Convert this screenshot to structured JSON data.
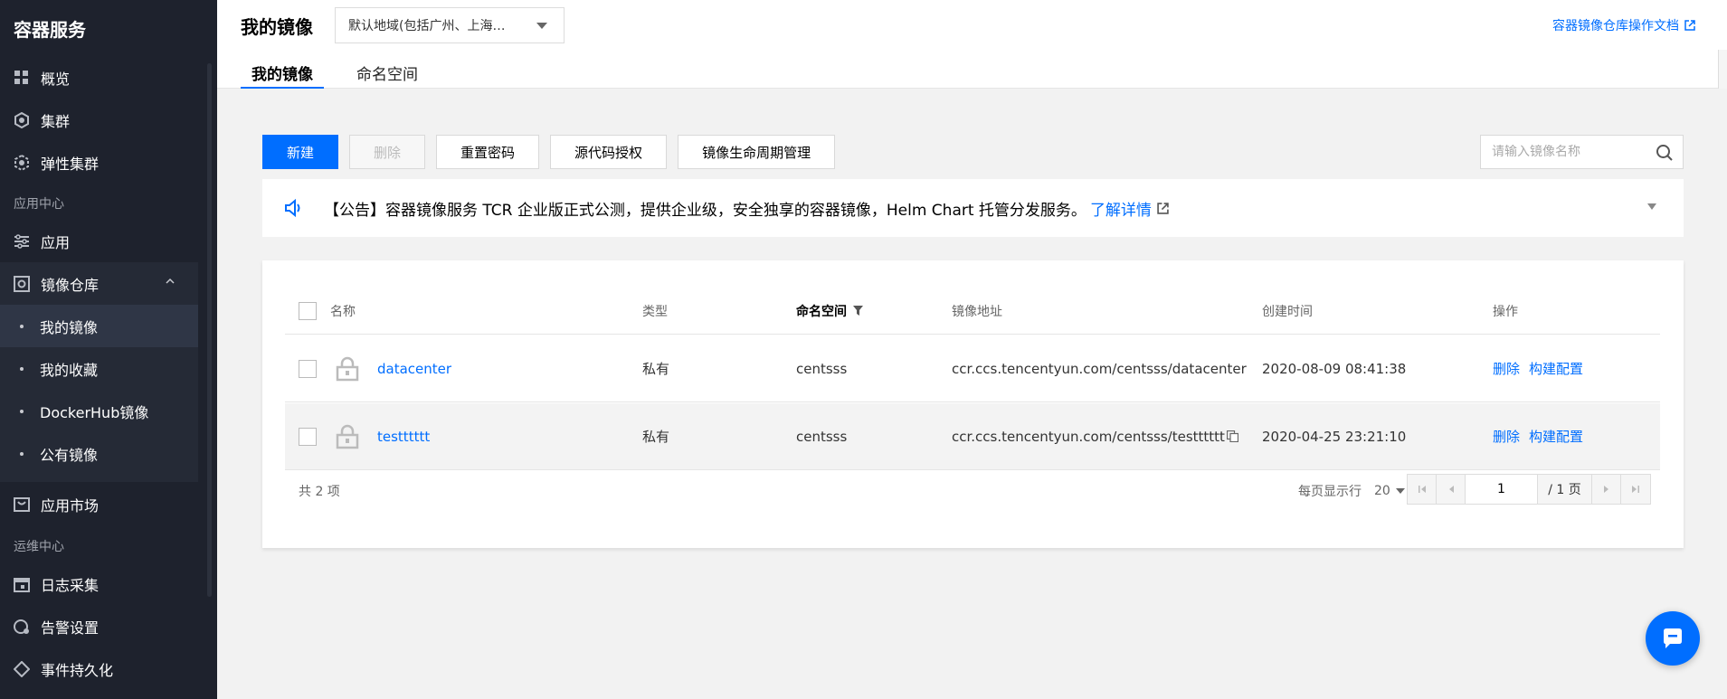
{
  "sidebar": {
    "brand": "容器服务",
    "items_top": [
      {
        "label": "概览",
        "icon": "grid-icon"
      },
      {
        "label": "集群",
        "icon": "cluster-icon"
      },
      {
        "label": "弹性集群",
        "icon": "elastic-cluster-icon"
      }
    ],
    "group_app": "应用中心",
    "app_item": {
      "label": "应用",
      "icon": "app-icon"
    },
    "registry": {
      "label": "镜像仓库",
      "icon": "registry-icon"
    },
    "registry_sub": [
      "我的镜像",
      "我的收藏",
      "DockerHub镜像",
      "公有镜像"
    ],
    "market": {
      "label": "应用市场",
      "icon": "market-icon"
    },
    "group_ops": "运维中心",
    "ops_items": [
      {
        "label": "日志采集",
        "icon": "calendar-icon"
      },
      {
        "label": "告警设置",
        "icon": "alarm-icon"
      },
      {
        "label": "事件持久化",
        "icon": "event-icon"
      }
    ]
  },
  "header": {
    "title": "我的镜像",
    "region": "默认地域(包括广州、上海…",
    "doc_link": "容器镜像仓库操作文档",
    "tabs": [
      "我的镜像",
      "命名空间"
    ]
  },
  "toolbar": {
    "new": "新建",
    "delete": "删除",
    "reset_pwd": "重置密码",
    "source_auth": "源代码授权",
    "lifecycle": "镜像生命周期管理",
    "search_placeholder": "请输入镜像名称"
  },
  "announcement": {
    "text": "【公告】容器镜像服务 TCR 企业版正式公测，提供企业级，安全独享的容器镜像，Helm Chart 托管分发服务。",
    "more": "了解详情"
  },
  "table": {
    "columns": {
      "name": "名称",
      "type": "类型",
      "namespace": "命名空间",
      "address": "镜像地址",
      "created": "创建时间",
      "actions": "操作"
    },
    "rows": [
      {
        "name": "datacenter",
        "type": "私有",
        "namespace": "centsss",
        "address": "ccr.ccs.tencentyun.com/centsss/datacenter",
        "created": "2020-08-09 08:41:38",
        "delete": "删除",
        "build": "构建配置"
      },
      {
        "name": "testttttt",
        "type": "私有",
        "namespace": "centsss",
        "address": "ccr.ccs.tencentyun.com/centsss/testttttt",
        "created": "2020-04-25 23:21:10",
        "delete": "删除",
        "build": "构建配置"
      }
    ],
    "footer": {
      "total": "共 2 项",
      "per_page_label": "每页显示行",
      "per_page": "20",
      "page": "1",
      "page_total": "/ 1 页"
    }
  },
  "colors": {
    "primary": "#006eff",
    "sidebar_bg": "#1e222d"
  }
}
